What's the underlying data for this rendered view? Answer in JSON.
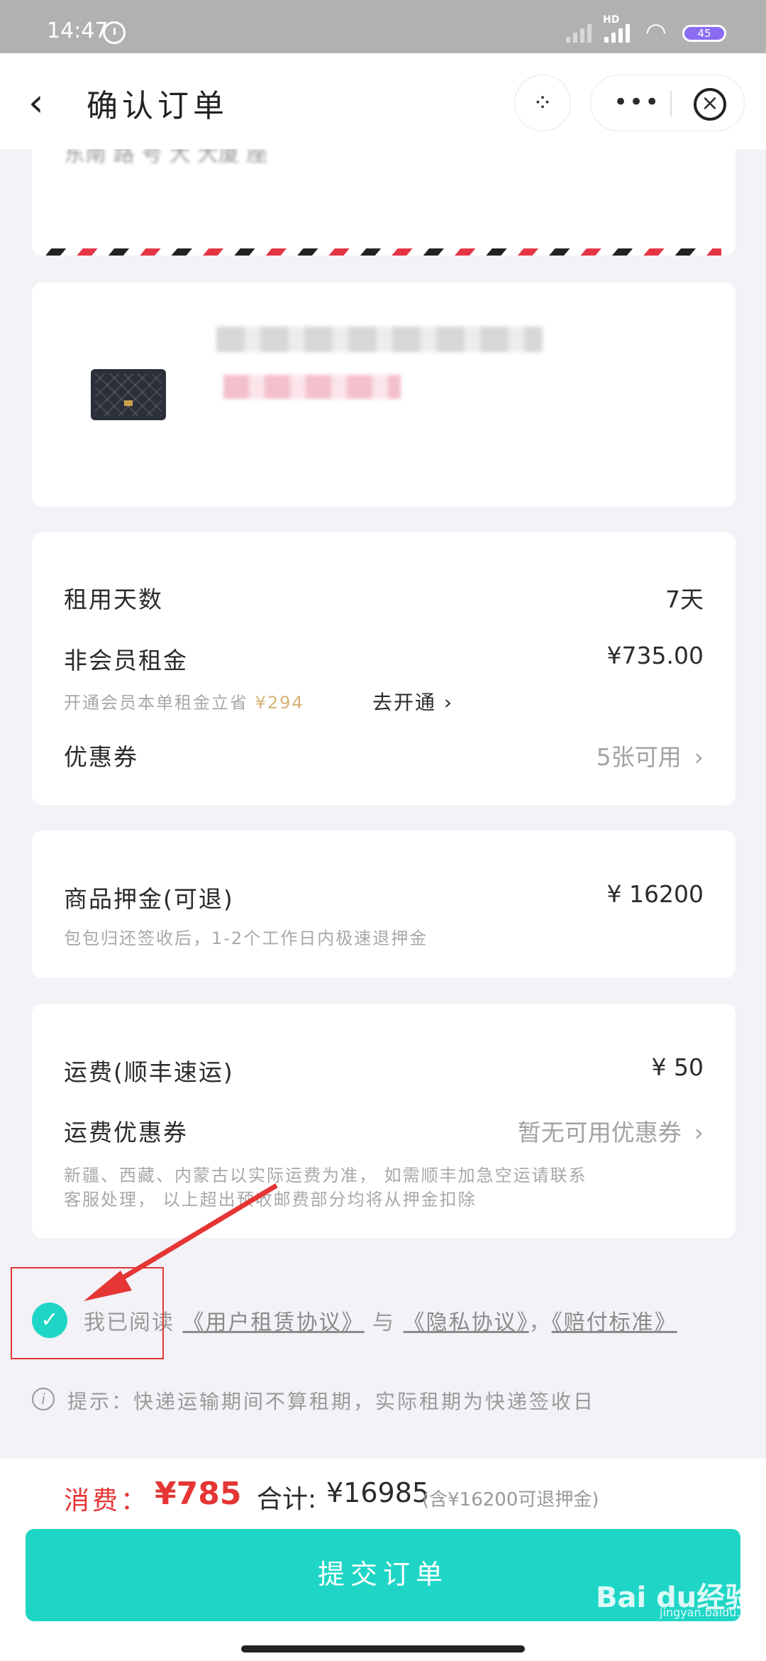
{
  "status": {
    "time": "14:47",
    "network": "HD",
    "battery": "45"
  },
  "nav": {
    "title": "确认订单"
  },
  "address": {
    "partial_text": "东南 路 号  大 大厦 座"
  },
  "rent": {
    "days_label": "租用天数",
    "days_value": "7天",
    "nonmember_label": "非会员租金",
    "nonmember_value": "¥735.00",
    "member_hint": "开通会员本单租金立省",
    "member_saving": "¥294",
    "open_member": "去开通",
    "coupon_label": "优惠券",
    "coupon_value": "5张可用"
  },
  "deposit": {
    "label": "商品押金(可退)",
    "value": "¥ 16200",
    "note": "包包归还签收后，1-2个工作日内极速退押金"
  },
  "shipping": {
    "label": "运费(顺丰速运)",
    "value": "¥ 50",
    "coupon_label": "运费优惠券",
    "coupon_value": "暂无可用优惠券",
    "note_line1": "新疆、西藏、内蒙古以实际运费为准， 如需顺丰加急空运请联系",
    "note_line2": "客服处理， 以上超出预收邮费部分均将从押金扣除"
  },
  "agreement": {
    "prefix": "我已阅读",
    "link1": "《用户租赁协议》",
    "mid": "与",
    "link2": "《隐私协议》",
    "comma": "，",
    "link3": "《赔付标准》"
  },
  "hint": {
    "text": "提示：快递运输期间不算租期，实际租期为快递签收日"
  },
  "footer": {
    "consume_label": "消费：",
    "consume_value": "¥785",
    "total_label": "合计:",
    "total_value": "¥16985",
    "total_note": "(含¥16200可退押金)",
    "submit_label": "提交订单"
  },
  "watermark": {
    "text": "Bai du经验",
    "sub": "jingyan.baidu.com"
  },
  "colors": {
    "accent": "#1fd6c6",
    "price_red": "#e53535",
    "gold": "#d6b378"
  }
}
